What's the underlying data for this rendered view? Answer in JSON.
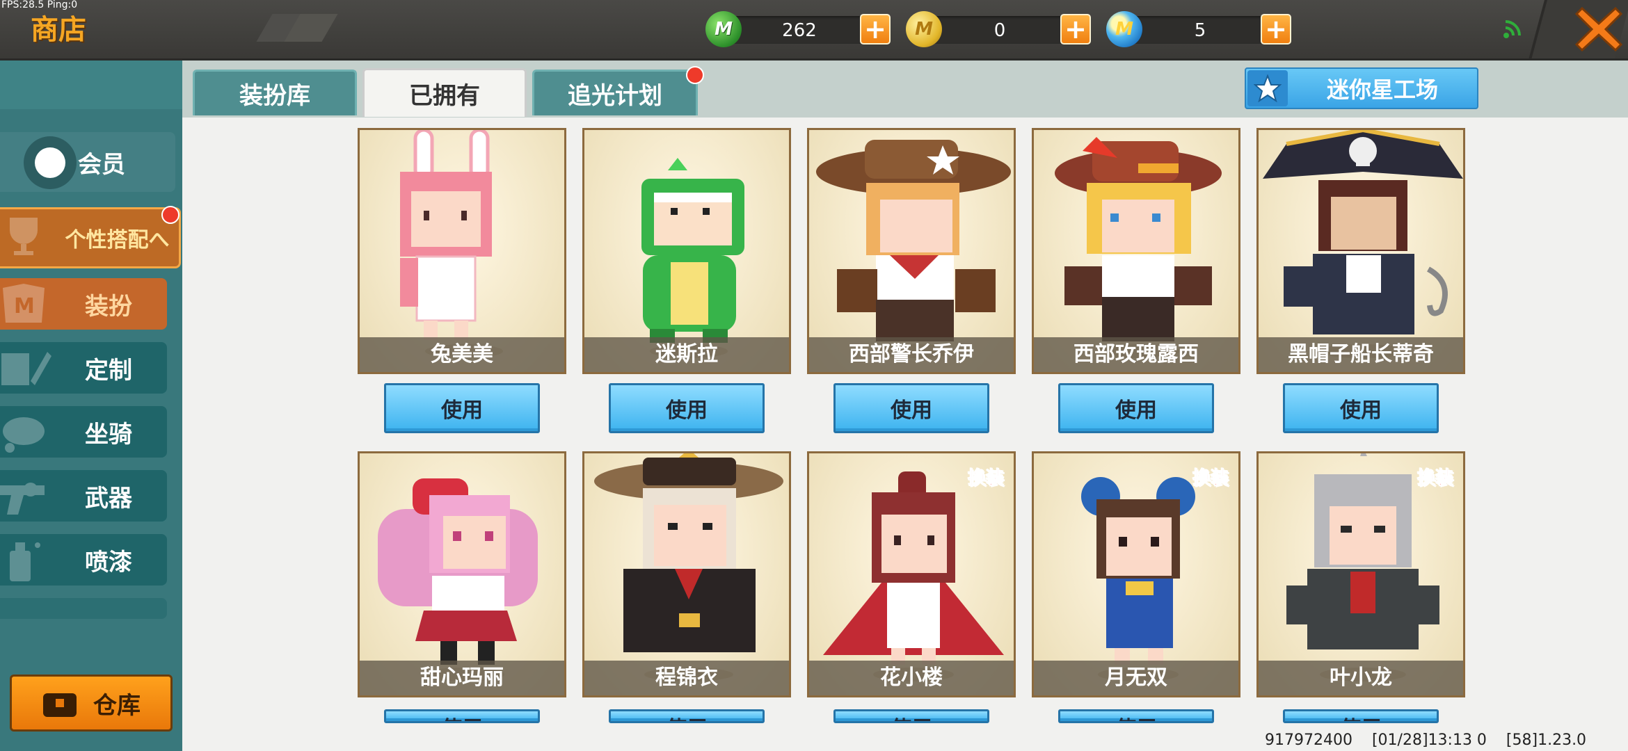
{
  "debug": {
    "fps_text": "FPS:28.5  Ping:0"
  },
  "header": {
    "title": "商店"
  },
  "currencies": [
    {
      "name": "mini-beans",
      "icon": "green-m-coin-icon",
      "value": "262"
    },
    {
      "name": "mini-coins",
      "icon": "gold-m-coin-icon",
      "value": "0"
    },
    {
      "name": "star-coins",
      "icon": "blue-m-coin-icon",
      "value": "5"
    }
  ],
  "colors": {
    "accent_orange": "#f5a623",
    "teal_sidebar": "#39787c",
    "button_blue": "#3db3ef",
    "notify_red": "#ee3a2a"
  },
  "sidebar": {
    "vip_label": "会员",
    "outfit_label": "个性搭配へ",
    "items": [
      {
        "label": "装扮",
        "icon": "dress-m-icon",
        "selected": true
      },
      {
        "label": "定制",
        "icon": "pencil-icon"
      },
      {
        "label": "坐骑",
        "icon": "mount-icon"
      },
      {
        "label": "武器",
        "icon": "gun-icon"
      },
      {
        "label": "喷漆",
        "icon": "spray-can-icon"
      }
    ],
    "warehouse_label": "仓库"
  },
  "tabs": [
    {
      "label": "装扮库",
      "active": false
    },
    {
      "label": "已拥有",
      "active": true
    },
    {
      "label": "追光计划",
      "active": false,
      "notify": true
    }
  ],
  "workshop_button": "迷你星工场",
  "skins": [
    {
      "name": "兔美美",
      "button": "使用"
    },
    {
      "name": "迷斯拉",
      "button": "使用"
    },
    {
      "name": "西部警长乔伊",
      "button": "使用"
    },
    {
      "name": "西部玫瑰露西",
      "button": "使用"
    },
    {
      "name": "黑帽子船长蒂奇",
      "button": "使用"
    },
    {
      "name": "甜心玛丽",
      "button": "使用"
    },
    {
      "name": "程锦衣",
      "button": "使用"
    },
    {
      "name": "花小楼",
      "button": "使用",
      "badge": "换装"
    },
    {
      "name": "月无双",
      "button": "使用",
      "badge": "换装"
    },
    {
      "name": "叶小龙",
      "button": "使用",
      "badge": "换装"
    }
  ],
  "footer": {
    "uid": "917972400",
    "time": "[01/28]13:13 0",
    "version": "[58]1.23.0"
  }
}
